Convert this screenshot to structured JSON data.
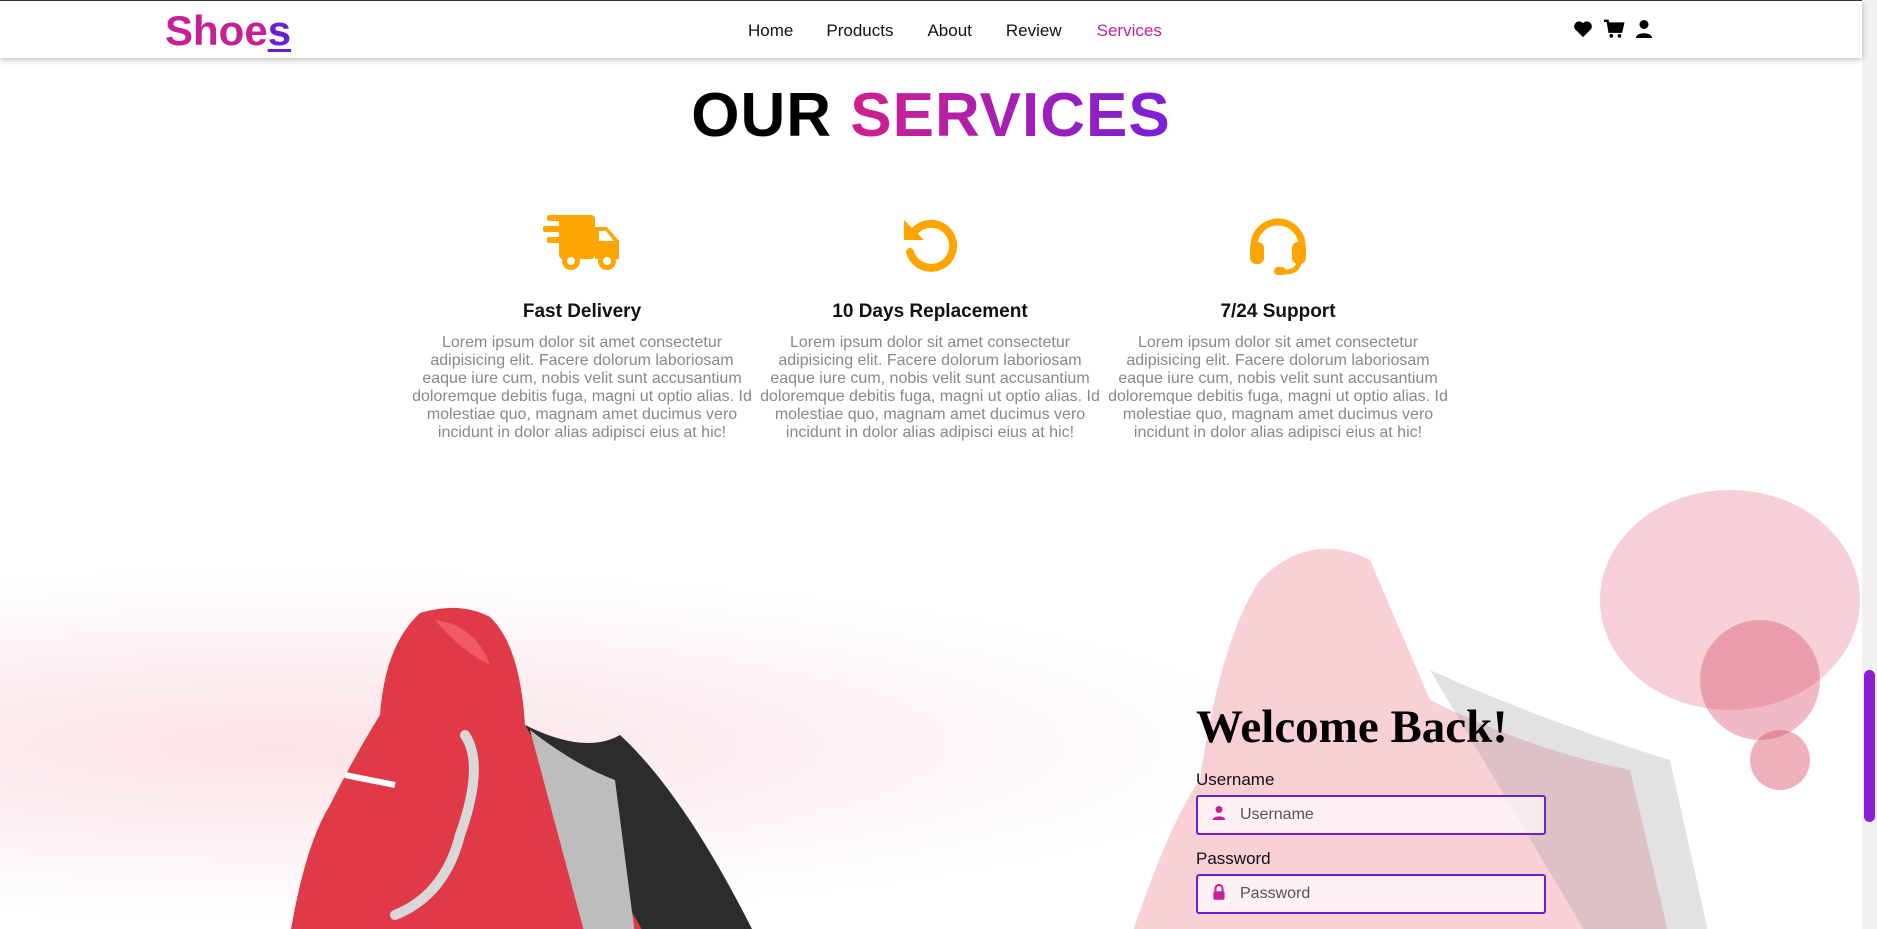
{
  "nav": {
    "logo_main": "Shoe",
    "logo_last": "s",
    "links": [
      "Home",
      "Products",
      "About",
      "Review",
      "Services"
    ],
    "active_link": "Services",
    "icons": [
      "heart-icon",
      "cart-icon",
      "user-icon"
    ]
  },
  "services": {
    "title_plain": "OUR",
    "title_accent": "SERVICES",
    "items": [
      {
        "icon": "truck-icon",
        "heading": "Fast Delivery",
        "text": "Lorem ipsum dolor sit amet consectetur adipisicing elit. Facere dolorum laboriosam eaque iure cum, nobis velit sunt accusantium doloremque debitis fuga, magni ut optio alias. Id molestiae quo, magnam amet ducimus vero incidunt in dolor alias adipisci eius at hic!"
      },
      {
        "icon": "rotate-icon",
        "heading": "10 Days Replacement",
        "text": "Lorem ipsum dolor sit amet consectetur adipisicing elit. Facere dolorum laboriosam eaque iure cum, nobis velit sunt accusantium doloremque debitis fuga, magni ut optio alias. Id molestiae quo, magnam amet ducimus vero incidunt in dolor alias adipisci eius at hic!"
      },
      {
        "icon": "headset-icon",
        "heading": "7/24 Support",
        "text": "Lorem ipsum dolor sit amet consectetur adipisicing elit. Facere dolorum laboriosam eaque iure cum, nobis velit sunt accusantium doloremque debitis fuga, magni ut optio alias. Id molestiae quo, magnam amet ducimus vero incidunt in dolor alias adipisci eius at hic!"
      }
    ]
  },
  "login": {
    "heading": "Welcome Back!",
    "username_label": "Username",
    "username_placeholder": "Username",
    "password_label": "Password",
    "password_placeholder": "Password"
  },
  "colors": {
    "brand_pink": "#c71f96",
    "brand_purple": "#6a1fd0",
    "icon_orange": "#ffa500"
  }
}
